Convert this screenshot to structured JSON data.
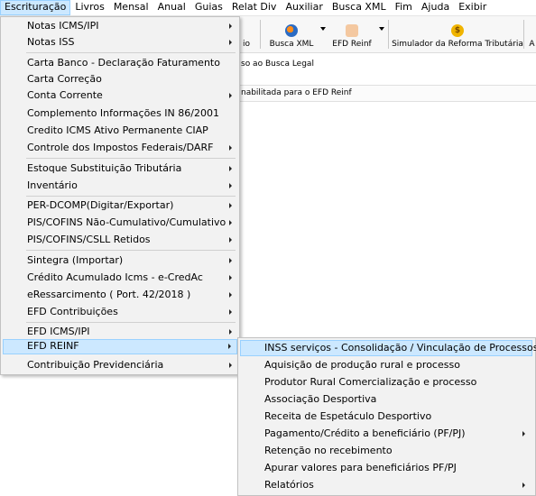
{
  "menubar": {
    "items": [
      "Escrituração",
      "Livros",
      "Mensal",
      "Anual",
      "Guias",
      "Relat Div",
      "Auxiliar",
      "Busca XML",
      "Fim",
      "Ajuda",
      "Exibir"
    ],
    "active_index": 0
  },
  "toolbar": {
    "partial_label": "io",
    "buttons": [
      {
        "label": "Busca XML",
        "icon": "busca-xml-icon"
      },
      {
        "label": "EFD Reinf",
        "icon": "efd-reinf-icon"
      },
      {
        "label": "Simulador da Reforma Tributária",
        "icon": "dollar-coin-icon"
      }
    ],
    "edge_label": "A"
  },
  "info": {
    "line1": "so ao Busca Legal",
    "line2": "nabilitada para o EFD Reinf"
  },
  "dropdown": {
    "items": [
      {
        "label": "Notas ICMS/IPI",
        "submenu": true
      },
      {
        "label": "Notas ISS",
        "submenu": true
      },
      {
        "label": "Carta Banco - Declaração Faturamento",
        "submenu": false
      },
      {
        "label": "Carta Correção",
        "submenu": false
      },
      {
        "label": "Conta Corrente",
        "submenu": true
      },
      {
        "label": "Complemento Informações IN 86/2001",
        "submenu": false
      },
      {
        "label": "Credito ICMS Ativo Permanente CIAP",
        "submenu": false
      },
      {
        "label": "Controle dos Impostos Federais/DARF",
        "submenu": true
      },
      {
        "label": "Estoque Substituição Tributária",
        "submenu": true
      },
      {
        "label": "Inventário",
        "submenu": true
      },
      {
        "label": "PER-DCOMP(Digitar/Exportar)",
        "submenu": true
      },
      {
        "label": "PIS/COFINS Não-Cumulativo/Cumulativo",
        "submenu": true
      },
      {
        "label": "PIS/COFINS/CSLL Retidos",
        "submenu": true
      },
      {
        "label": "Sintegra (Importar)",
        "submenu": true
      },
      {
        "label": "Crédito Acumulado Icms - e-CredAc",
        "submenu": true
      },
      {
        "label": "eRessarcimento ( Port. 42/2018 )",
        "submenu": true
      },
      {
        "label": "EFD Contribuições",
        "submenu": true
      },
      {
        "label": "EFD ICMS/IPI",
        "submenu": true
      },
      {
        "label": "EFD REINF",
        "submenu": true
      },
      {
        "label": "Contribuição Previdenciária",
        "submenu": true
      }
    ],
    "highlighted_index": 18
  },
  "submenu": {
    "items": [
      {
        "label": "INSS serviços - Consolidação / Vinculação de Processos",
        "submenu": false
      },
      {
        "label": "Aquisição de produção rural e processo",
        "submenu": false
      },
      {
        "label": "Produtor Rural Comercialização e processo",
        "submenu": false
      },
      {
        "label": "Associação Desportiva",
        "submenu": false
      },
      {
        "label": "Receita de Espetáculo Desportivo",
        "submenu": false
      },
      {
        "label": "Pagamento/Crédito a beneficiário (PF/PJ)",
        "submenu": true
      },
      {
        "label": "Retenção no recebimento",
        "submenu": false
      },
      {
        "label": "Apurar valores para beneficiários PF/PJ",
        "submenu": false
      },
      {
        "label": "Relatórios",
        "submenu": true
      }
    ],
    "highlighted_index": 0
  },
  "colors": {
    "highlight_bg": "#cce8ff",
    "highlight_border": "#99d1ff",
    "menu_bg": "#f2f2f2"
  }
}
